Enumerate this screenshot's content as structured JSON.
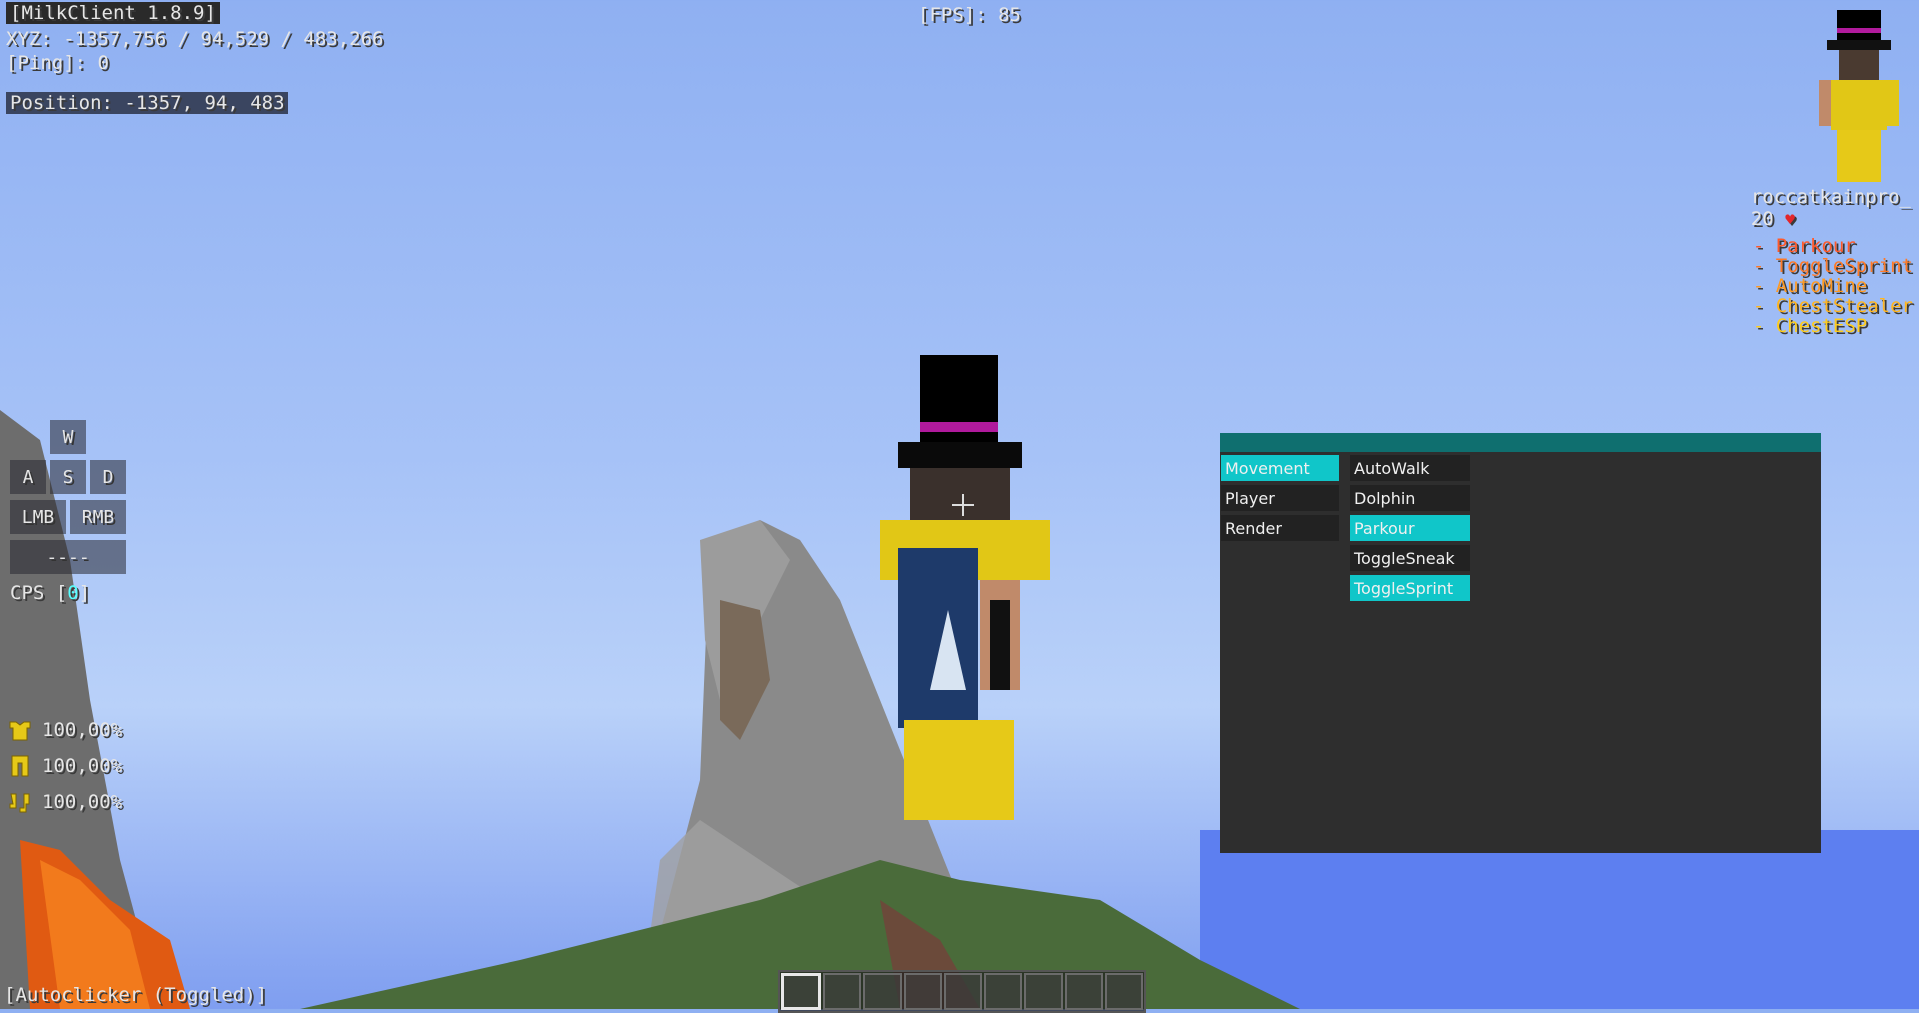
{
  "hud": {
    "client_title": "[MilkClient 1.8.9]",
    "coords": "XYZ: -1357,756 / 94,529 / 483,266",
    "ping": "[Ping]: 0",
    "position": "Position: -1357, 94, 483",
    "fps": "[FPS]: 85",
    "autoclicker": "[Autoclicker (Toggled)]"
  },
  "keystrokes": {
    "w": "W",
    "a": "A",
    "s": "S",
    "d": "D",
    "lmb": "LMB",
    "rmb": "RMB",
    "space": "----",
    "cps_label": "CPS [",
    "cps_value": "0",
    "cps_end": "]"
  },
  "armor": [
    {
      "icon": "chestplate-icon",
      "value": "100,00%"
    },
    {
      "icon": "leggings-icon",
      "value": "100,00%"
    },
    {
      "icon": "boots-icon",
      "value": "100,00%"
    }
  ],
  "player": {
    "name": "roccatkainpro_",
    "health": "20"
  },
  "enabled_modules": [
    {
      "label": "- Parkour",
      "color": "#ff5a2a"
    },
    {
      "label": "- ToggleSprint",
      "color": "#ff7a26"
    },
    {
      "label": "- AutoMine",
      "color": "#ff9a22"
    },
    {
      "label": "- ChestStealer",
      "color": "#ffb51f"
    },
    {
      "label": "- ChestESP",
      "color": "#ffcc1c"
    }
  ],
  "clickgui": {
    "categories": [
      "Movement",
      "Player",
      "Render"
    ],
    "selected_category": "Movement",
    "modules": [
      "AutoWalk",
      "Dolphin",
      "Parkour",
      "ToggleSneak",
      "ToggleSprint"
    ],
    "enabled": [
      "Parkour",
      "ToggleSprint"
    ],
    "accent": "#10c6c9",
    "header_color": "#0f6f6f"
  }
}
